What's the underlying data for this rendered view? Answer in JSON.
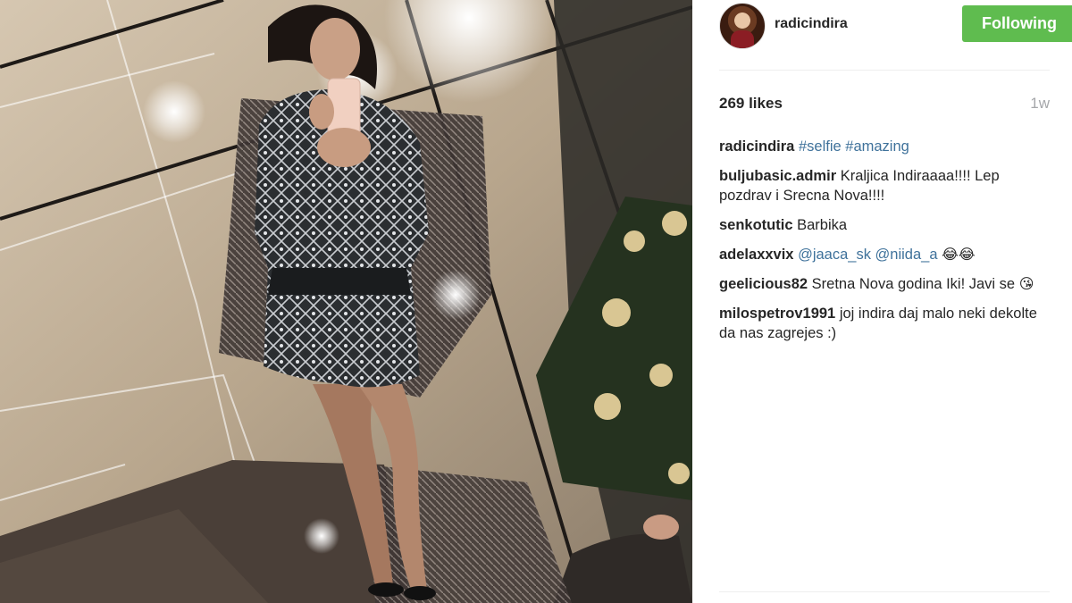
{
  "post": {
    "photo_alt": "mirror selfie"
  },
  "header": {
    "username": "radicindira",
    "follow_label": "Following"
  },
  "stats": {
    "likes": "269 likes",
    "time": "1w"
  },
  "caption": {
    "user": "radicindira",
    "tags": [
      "#selfie",
      "#amazing"
    ]
  },
  "comments": [
    {
      "user": "buljubasic.admir",
      "text": "Kraljica Indiraaaa!!!! Lep pozdrav i Srecna Nova!!!!"
    },
    {
      "user": "senkotutic",
      "text": "Barbika"
    },
    {
      "user": "adelaxxvix",
      "mentions": [
        "@jaaca_sk",
        "@niida_a"
      ],
      "emoji": [
        "😂",
        "😂"
      ]
    },
    {
      "user": "geelicious82",
      "text": "Sretna Nova godina Iki! Javi se",
      "emoji": [
        "😘"
      ]
    },
    {
      "user": "milospetrov1991",
      "text": "joj indira daj malo neki dekolte da nas zagrejes :)"
    }
  ],
  "colors": {
    "follow_button": "#5fbc4f",
    "hashtag": "#3f729b",
    "text": "#262626",
    "muted": "#a5a7aa"
  }
}
